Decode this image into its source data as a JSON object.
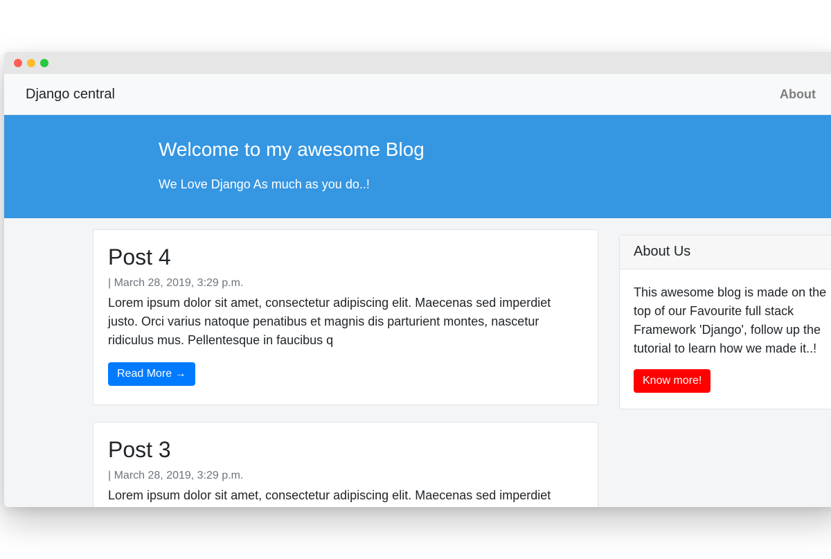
{
  "window": {
    "controls": [
      "close",
      "minimize",
      "maximize"
    ]
  },
  "navbar": {
    "brand": "Django central",
    "links": [
      "About"
    ]
  },
  "hero": {
    "title": "Welcome to my awesome Blog",
    "subtitle": "We Love Django As much as you do..!"
  },
  "posts": [
    {
      "title": "Post 4",
      "meta": "| March 28, 2019, 3:29 p.m.",
      "excerpt": "Lorem ipsum dolor sit amet, consectetur adipiscing elit. Maecenas sed imperdiet justo. Orci varius natoque penatibus et magnis dis parturient montes, nascetur ridiculus mus. Pellentesque in faucibus q",
      "button": "Read More →"
    },
    {
      "title": "Post 3",
      "meta": "| March 28, 2019, 3:29 p.m.",
      "excerpt": "Lorem ipsum dolor sit amet, consectetur adipiscing elit. Maecenas sed imperdiet"
    }
  ],
  "sidebar": {
    "header": "About Us",
    "text": "This awesome blog is made on the top of our Favourite full stack Framework 'Django', follow up the tutorial to learn how we made it..!",
    "button": "Know more!"
  },
  "colors": {
    "hero": "#3596e2",
    "read_more": "#007bff",
    "know_more": "#ff0000"
  }
}
